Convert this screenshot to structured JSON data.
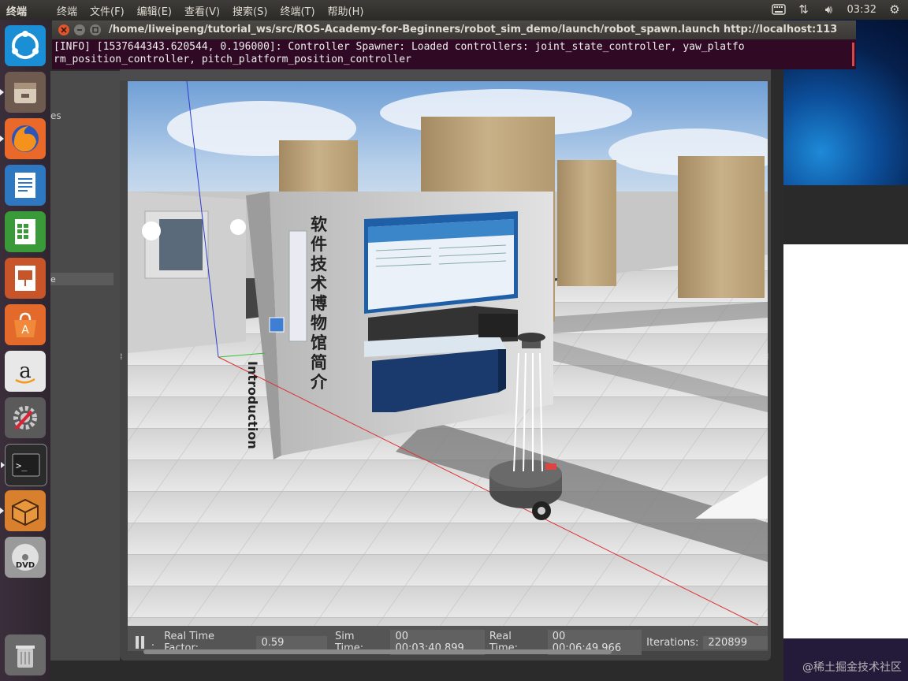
{
  "topbar": {
    "app_title": "终端",
    "menus": [
      "终端",
      "文件(F)",
      "编辑(E)",
      "查看(V)",
      "搜索(S)",
      "终端(T)",
      "帮助(H)"
    ],
    "clock": "03:32",
    "tray_icons": [
      "keyboard-icon",
      "network-icon",
      "volume-icon",
      "power-icon"
    ]
  },
  "launcher": {
    "items": [
      "ubuntu-dash-icon",
      "files-icon",
      "firefox-icon",
      "writer-icon",
      "calc-icon",
      "impress-icon",
      "software-center-icon",
      "amazon-icon",
      "system-settings-icon",
      "terminal-icon",
      "gazebo-icon",
      "dvd-icon",
      "trash-icon"
    ]
  },
  "terminal": {
    "title": "/home/liweipeng/tutorial_ws/src/ROS-Academy-for-Beginners/robot_sim_demo/launch/robot_spawn.launch http://localhost:113",
    "line1": "[INFO] [1537644343.620544, 0.196000]: Controller Spawner: Loaded controllers: joint_state_controller, yaw_platfo",
    "line2": "rm_position_controller, pitch_platform_position_controller"
  },
  "side_panel": {
    "partial_text": "es",
    "partial_selected": "e"
  },
  "scene": {
    "board_title": "软件技术博物馆简介",
    "board_subtitle": "Introduction"
  },
  "status_bar": {
    "dot": ".",
    "rtf_label": "Real Time Factor:",
    "rtf_value": "0.59",
    "sim_label": "Sim Time:",
    "sim_value": "00 00:03:40.899",
    "real_label": "Real Time:",
    "real_value": "00 00:06:49.966",
    "iter_label": "Iterations:",
    "iter_value": "220899"
  },
  "watermark": "@稀土掘金技术社区",
  "colors": {
    "terminal_bg": "#300a24",
    "launcher_bg": "#3a2e3b",
    "topbar_bg": "#3d3c38"
  }
}
